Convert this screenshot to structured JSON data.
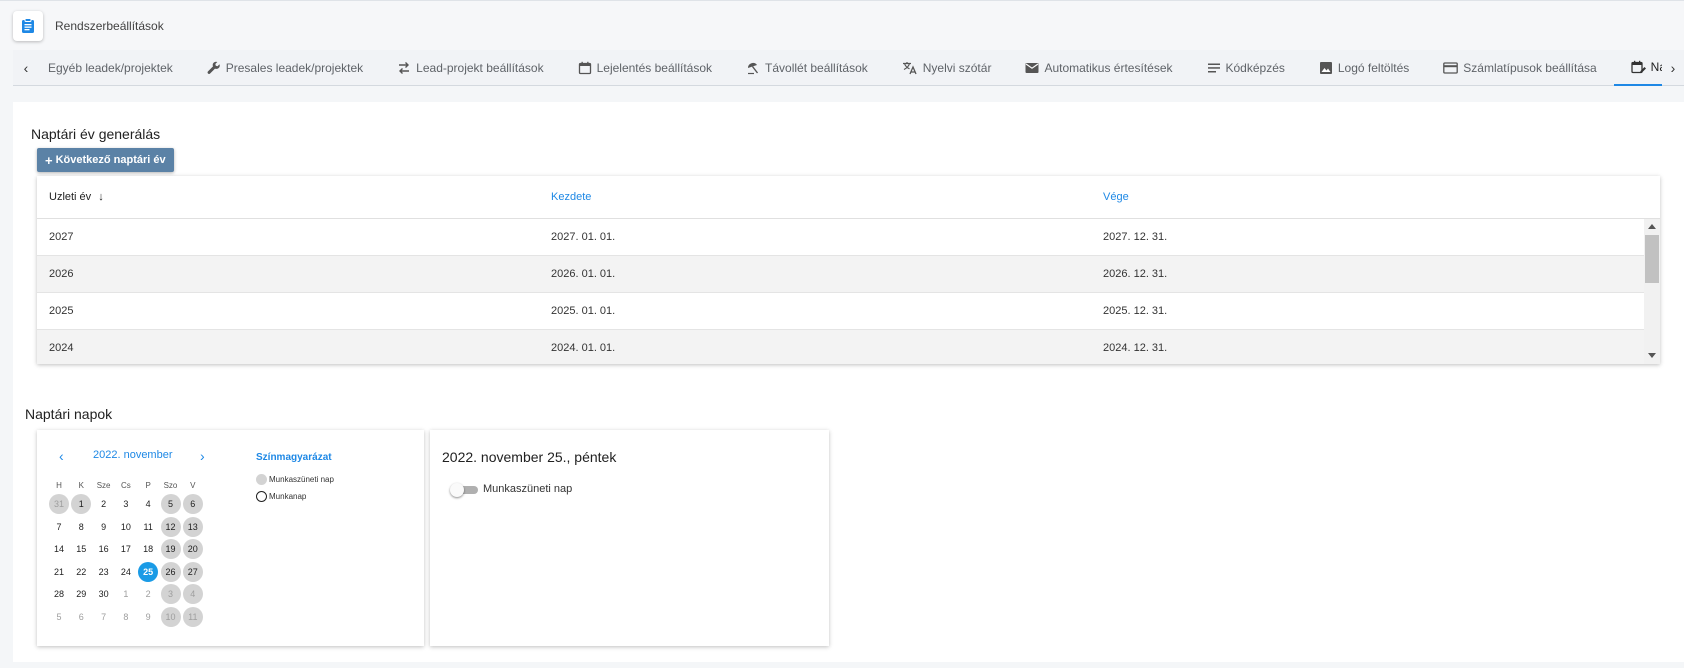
{
  "app": {
    "title": "Rendszerbeállítások",
    "icon": "clipboard-icon"
  },
  "tabs": [
    {
      "label": "Egyéb leadek/projektek",
      "icon": ""
    },
    {
      "label": "Presales leadek/projektek",
      "icon": "wrench-icon"
    },
    {
      "label": "Lead-projekt beállítások",
      "icon": "swap-icon"
    },
    {
      "label": "Lejelentés beállítások",
      "icon": "calendar-icon"
    },
    {
      "label": "Távollét beállítások",
      "icon": "umbrella-icon"
    },
    {
      "label": "Nyelvi szótár",
      "icon": "translate-icon"
    },
    {
      "label": "Automatikus értesítések",
      "icon": "mail-icon"
    },
    {
      "label": "Kódképzés",
      "icon": "lines-icon"
    },
    {
      "label": "Logó feltöltés",
      "icon": "image-icon"
    },
    {
      "label": "Számlatípusok beállítása",
      "icon": "card-icon"
    },
    {
      "label": "Naptár adatok",
      "icon": "calendar-edit-icon",
      "active": true
    }
  ],
  "fiscal": {
    "title": "Naptári év generálás",
    "button_label": "Következő naptári év",
    "columns": [
      "Uzleti év",
      "Kezdete",
      "Vége"
    ],
    "sort_indicator": "↓",
    "rows": [
      [
        "2027",
        "2027. 01. 01.",
        "2027. 12. 31."
      ],
      [
        "2026",
        "2026. 01. 01.",
        "2026. 12. 31."
      ],
      [
        "2025",
        "2025. 01. 01.",
        "2025. 12. 31."
      ],
      [
        "2024",
        "2024. 01. 01.",
        "2024. 12. 31."
      ]
    ]
  },
  "calendar": {
    "title": "Naptári napok",
    "month_label": "2022. november",
    "weekdays": [
      "H",
      "K",
      "Sze",
      "Cs",
      "P",
      "Szo",
      "V"
    ],
    "weeks": [
      [
        {
          "d": "31",
          "t": "oh"
        },
        {
          "d": "1",
          "t": "h"
        },
        {
          "d": "2",
          "t": "w"
        },
        {
          "d": "3",
          "t": "w"
        },
        {
          "d": "4",
          "t": "w"
        },
        {
          "d": "5",
          "t": "h"
        },
        {
          "d": "6",
          "t": "h"
        }
      ],
      [
        {
          "d": "7",
          "t": "w"
        },
        {
          "d": "8",
          "t": "w"
        },
        {
          "d": "9",
          "t": "w"
        },
        {
          "d": "10",
          "t": "w"
        },
        {
          "d": "11",
          "t": "w"
        },
        {
          "d": "12",
          "t": "h"
        },
        {
          "d": "13",
          "t": "h"
        }
      ],
      [
        {
          "d": "14",
          "t": "w"
        },
        {
          "d": "15",
          "t": "w"
        },
        {
          "d": "16",
          "t": "w"
        },
        {
          "d": "17",
          "t": "w"
        },
        {
          "d": "18",
          "t": "w"
        },
        {
          "d": "19",
          "t": "h"
        },
        {
          "d": "20",
          "t": "h"
        }
      ],
      [
        {
          "d": "21",
          "t": "w"
        },
        {
          "d": "22",
          "t": "w"
        },
        {
          "d": "23",
          "t": "w"
        },
        {
          "d": "24",
          "t": "w"
        },
        {
          "d": "25",
          "t": "s"
        },
        {
          "d": "26",
          "t": "h"
        },
        {
          "d": "27",
          "t": "h"
        }
      ],
      [
        {
          "d": "28",
          "t": "w"
        },
        {
          "d": "29",
          "t": "w"
        },
        {
          "d": "30",
          "t": "w"
        },
        {
          "d": "1",
          "t": "o"
        },
        {
          "d": "2",
          "t": "o"
        },
        {
          "d": "3",
          "t": "oh"
        },
        {
          "d": "4",
          "t": "oh"
        }
      ],
      [
        {
          "d": "5",
          "t": "o"
        },
        {
          "d": "6",
          "t": "o"
        },
        {
          "d": "7",
          "t": "o"
        },
        {
          "d": "8",
          "t": "o"
        },
        {
          "d": "9",
          "t": "o"
        },
        {
          "d": "10",
          "t": "oh"
        },
        {
          "d": "11",
          "t": "oh"
        }
      ]
    ],
    "legend": {
      "title": "Színmagyarázat",
      "holiday_label": "Munkaszüneti nap",
      "workday_label": "Munkanap"
    }
  },
  "detail": {
    "title": "2022. november 25., péntek",
    "toggle_label": "Munkaszüneti nap",
    "toggle_on": false
  },
  "colors": {
    "accent": "#1e88e5",
    "button": "#5b82a6",
    "selected_day": "#1a9be6",
    "holiday": "#d3d3d3"
  }
}
